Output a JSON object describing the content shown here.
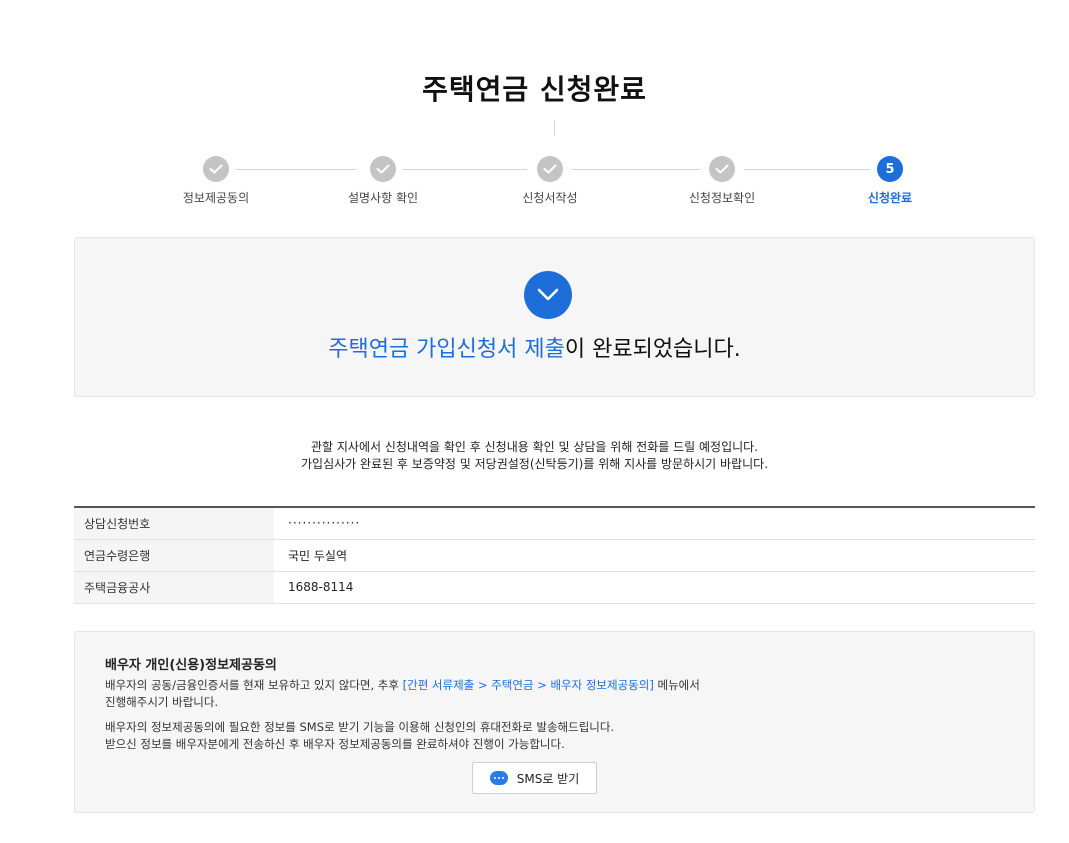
{
  "page": {
    "title": "주택연금 신청완료"
  },
  "stepper": {
    "steps": [
      {
        "label": "정보제공동의",
        "status": "done"
      },
      {
        "label": "설명사항 확인",
        "status": "done"
      },
      {
        "label": "신청서작성",
        "status": "done"
      },
      {
        "label": "신청정보확인",
        "status": "done"
      },
      {
        "label": "신청완료",
        "status": "active",
        "number": "5"
      }
    ]
  },
  "completion": {
    "highlight": "주택연금 가입신청서 제출",
    "suffix": "이 완료되었습니다."
  },
  "notice": {
    "line1": "관할 지사에서 신청내역을 확인 후 신청내용 확인 및 상담을 위해 전화를 드릴 예정입니다.",
    "line2": "가입심사가 완료된 후 보증약정 및 저당권설정(신탁등기)를 위해 지사를 방문하시기 바랍니다."
  },
  "info_table": {
    "rows": [
      {
        "label": "상담신청번호",
        "value": "···············"
      },
      {
        "label": "연금수령은행",
        "value": "국민 두실역"
      },
      {
        "label": "주택금융공사",
        "value": "1688-8114"
      }
    ]
  },
  "spouse_consent": {
    "title": "배우자 개인(신용)정보제공동의",
    "p1_before": "배우자의 공동/금융인증서를 현재 보유하고 있지 않다면, 추후 ",
    "p1_link": "[간편 서류제출 > 주택연금 > 배우자 정보제공동의]",
    "p1_after": " 메뉴에서",
    "p1_line2": "진행해주시기 바랍니다.",
    "p2_line1": "배우자의 정보제공동의에 필요한 정보를 SMS로 받기 기능을 이용해 신청인의 휴대전화로 발송해드립니다.",
    "p2_line2": "받으신 정보를 배우자분에게 전송하신 후 배우자 정보제공동의를 완료하셔야 진행이 가능합니다.",
    "sms_button_label": "SMS로 받기"
  },
  "colors": {
    "accent": "#1e6ed9",
    "done_step": "#c4c4c4",
    "box_bg": "#f6f6f7"
  }
}
